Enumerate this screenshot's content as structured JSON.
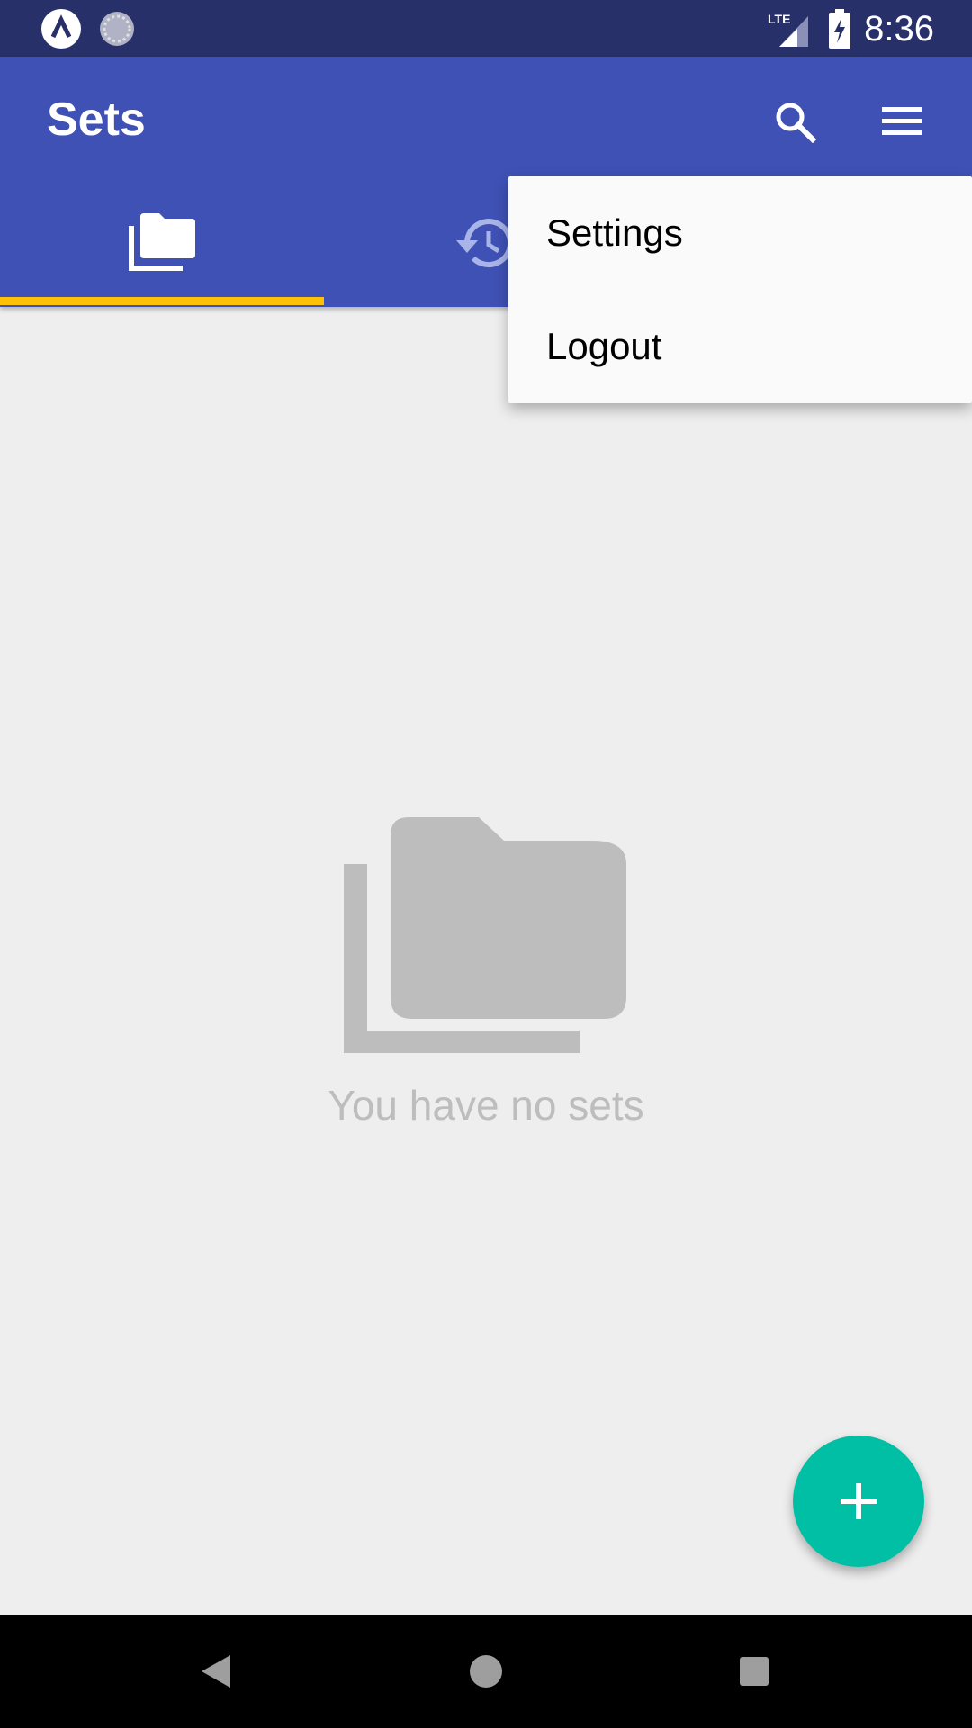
{
  "status_bar": {
    "time": "8:36",
    "network": "LTE",
    "icons": [
      "app-notification-icon",
      "sync-icon",
      "signal-icon",
      "battery-charging-icon"
    ]
  },
  "app_bar": {
    "title": "Sets",
    "actions": [
      "search-icon",
      "menu-icon"
    ],
    "tabs": [
      {
        "icon": "folders-icon",
        "selected": true
      },
      {
        "icon": "history-icon",
        "selected": false
      }
    ],
    "colors": {
      "primary": "#3f51b5",
      "status": "#283069",
      "indicator": "#ffc107"
    }
  },
  "overflow_menu": {
    "items": [
      {
        "label": "Settings"
      },
      {
        "label": "Logout"
      }
    ]
  },
  "empty_state": {
    "icon": "folders-icon",
    "message": "You have no sets"
  },
  "fab": {
    "icon": "plus-icon",
    "color": "#00bfa5"
  },
  "nav_bar": {
    "buttons": [
      "back-icon",
      "home-icon",
      "recents-icon"
    ]
  }
}
